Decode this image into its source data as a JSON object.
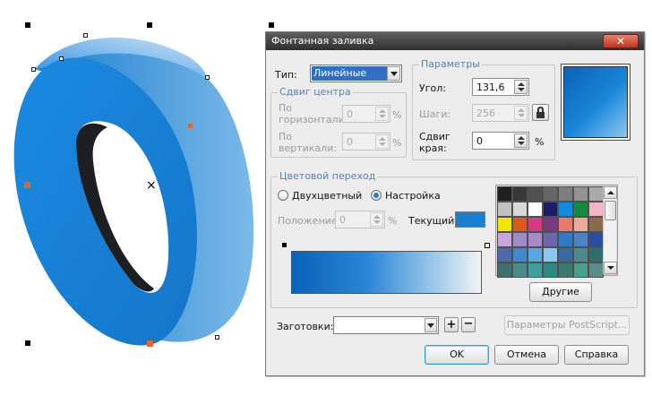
{
  "dialog": {
    "title": "Фонтанная заливка",
    "close_icon": "close-icon"
  },
  "type_section": {
    "label": "Тип:",
    "value": "Линейные"
  },
  "center_offset": {
    "title": "Сдвиг центра",
    "horizontal_label_1": "По",
    "horizontal_label_2": "горизонтали:",
    "horizontal_value": "0",
    "vertical_label_1": "По",
    "vertical_label_2": "вертикали:",
    "vertical_value": "0",
    "unit": "%"
  },
  "parameters": {
    "title": "Параметры",
    "angle_label": "Угол:",
    "angle_value": "131,6",
    "steps_label": "Шаги:",
    "steps_value": "256",
    "edge_label_1": "Сдвиг",
    "edge_label_2": "края:",
    "edge_value": "0",
    "unit": "%"
  },
  "color_blend": {
    "title": "Цветовой переход",
    "two_color_label": "Двухцветный",
    "custom_label": "Настройка",
    "selected": "custom",
    "position_label": "Положение:",
    "position_value": "0",
    "position_unit": "%",
    "current_label": "Текущий:",
    "current_color": "#1a7fd0",
    "gradient_start": "#0b62b9",
    "gradient_end": "#f2f4f6"
  },
  "palette": {
    "colors": [
      [
        "#202020",
        "#383838",
        "#505050",
        "#666666",
        "#7d7d7d",
        "#939393",
        "#a9a9a9"
      ],
      [
        "#c1c1c1",
        "#d8d8d8",
        "#ffffff",
        "#1c1c6a",
        "#0f8be0",
        "#148a3c",
        "#f6b3c6"
      ],
      [
        "#f2e600",
        "#e0571c",
        "#d63a86",
        "#7a3a82",
        "#e87a6b",
        "#f0a898",
        "#8c6b4a"
      ],
      [
        "#c8a6d8",
        "#9f8cc6",
        "#a58bc9",
        "#6c66aa",
        "#2f7ac4",
        "#4a83c6",
        "#2d4f9c"
      ],
      [
        "#4d6ba8",
        "#3e8ad0",
        "#5aa7e0",
        "#8ac8ec",
        "#3a6aa0",
        "#4a8c8c",
        "#2f6e6e"
      ],
      [
        "#3f6e6e",
        "#4a8a8a",
        "#3f9e9e",
        "#2e8a7c",
        "#3a7a6a",
        "#4a9e8e",
        "#5a8c8c"
      ]
    ],
    "other_button": "Другие"
  },
  "presets": {
    "label": "Заготовки:",
    "value": "",
    "add_icon": "plus-icon",
    "remove_icon": "minus-icon",
    "postscript_button": "Параметры PostScript..."
  },
  "buttons": {
    "ok": "OK",
    "cancel": "Отмена",
    "help": "Справка"
  }
}
